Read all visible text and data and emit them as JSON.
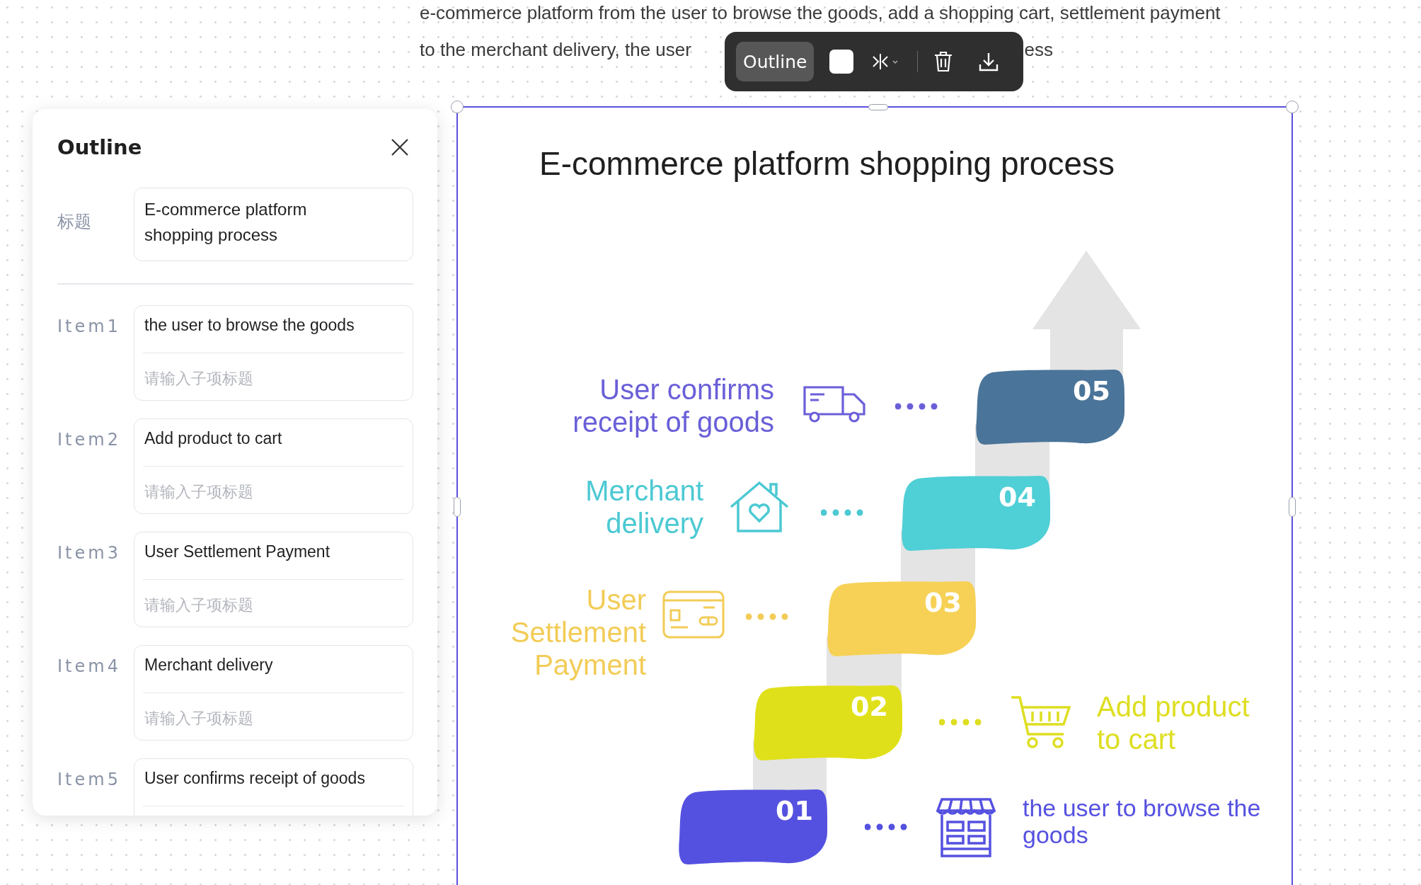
{
  "paragraph": {
    "line_1": "e-commerce platform from the user to browse the goods, add a shopping cart, settlement payment",
    "line_2_start": "to the merchant delivery, the user",
    "line_2_end": "ess"
  },
  "toolbar": {
    "outline_button": {
      "label": "Outline",
      "active": true
    },
    "tools": [
      {
        "kind": "swatch"
      },
      {
        "kind": "flip"
      },
      {
        "kind": "divider"
      },
      {
        "kind": "delete"
      },
      {
        "kind": "download"
      }
    ]
  },
  "outline_panel": {
    "title": "Outline",
    "title_field": {
      "label": "标题",
      "value": "E-commerce platform shopping process"
    },
    "items": [
      {
        "label": "Item1",
        "value": "the user to browse the goods",
        "placeholder": "请输入子项标题"
      },
      {
        "label": "Item2",
        "value": "Add product to cart",
        "placeholder": "请输入子项标题"
      },
      {
        "label": "Item3",
        "value": "User Settlement Payment",
        "placeholder": "请输入子项标题"
      },
      {
        "label": "Item4",
        "value": "Merchant delivery",
        "placeholder": "请输入子项标题"
      },
      {
        "label": "Item5",
        "value": "User confirms receipt of goods"
      }
    ]
  },
  "canvas": {
    "title": "E-commerce platform shopping process",
    "steps": [
      {
        "number": "05",
        "kind": "truck",
        "color": "#4a7499",
        "label": {
          "text": "User confirms receipt of goods",
          "color": "#6a5fd8"
        }
      },
      {
        "number": "04",
        "kind": "house",
        "color": "#4fcfd6",
        "label": {
          "text": "Merchant delivery",
          "color": "#4cc9d3"
        }
      },
      {
        "number": "03",
        "kind": "card",
        "color": "#f6d155",
        "label": {
          "text": "User Settlement Payment",
          "color": "#f2cc57"
        }
      },
      {
        "number": "02",
        "kind": "cart",
        "color": "#e0e01a",
        "label": {
          "text": "Add product to cart",
          "color": "#dede22"
        }
      },
      {
        "number": "01",
        "kind": "store",
        "color": "#5551e0",
        "label": {
          "text": "the user to browse the goods",
          "color": "#5551e0"
        }
      }
    ]
  }
}
